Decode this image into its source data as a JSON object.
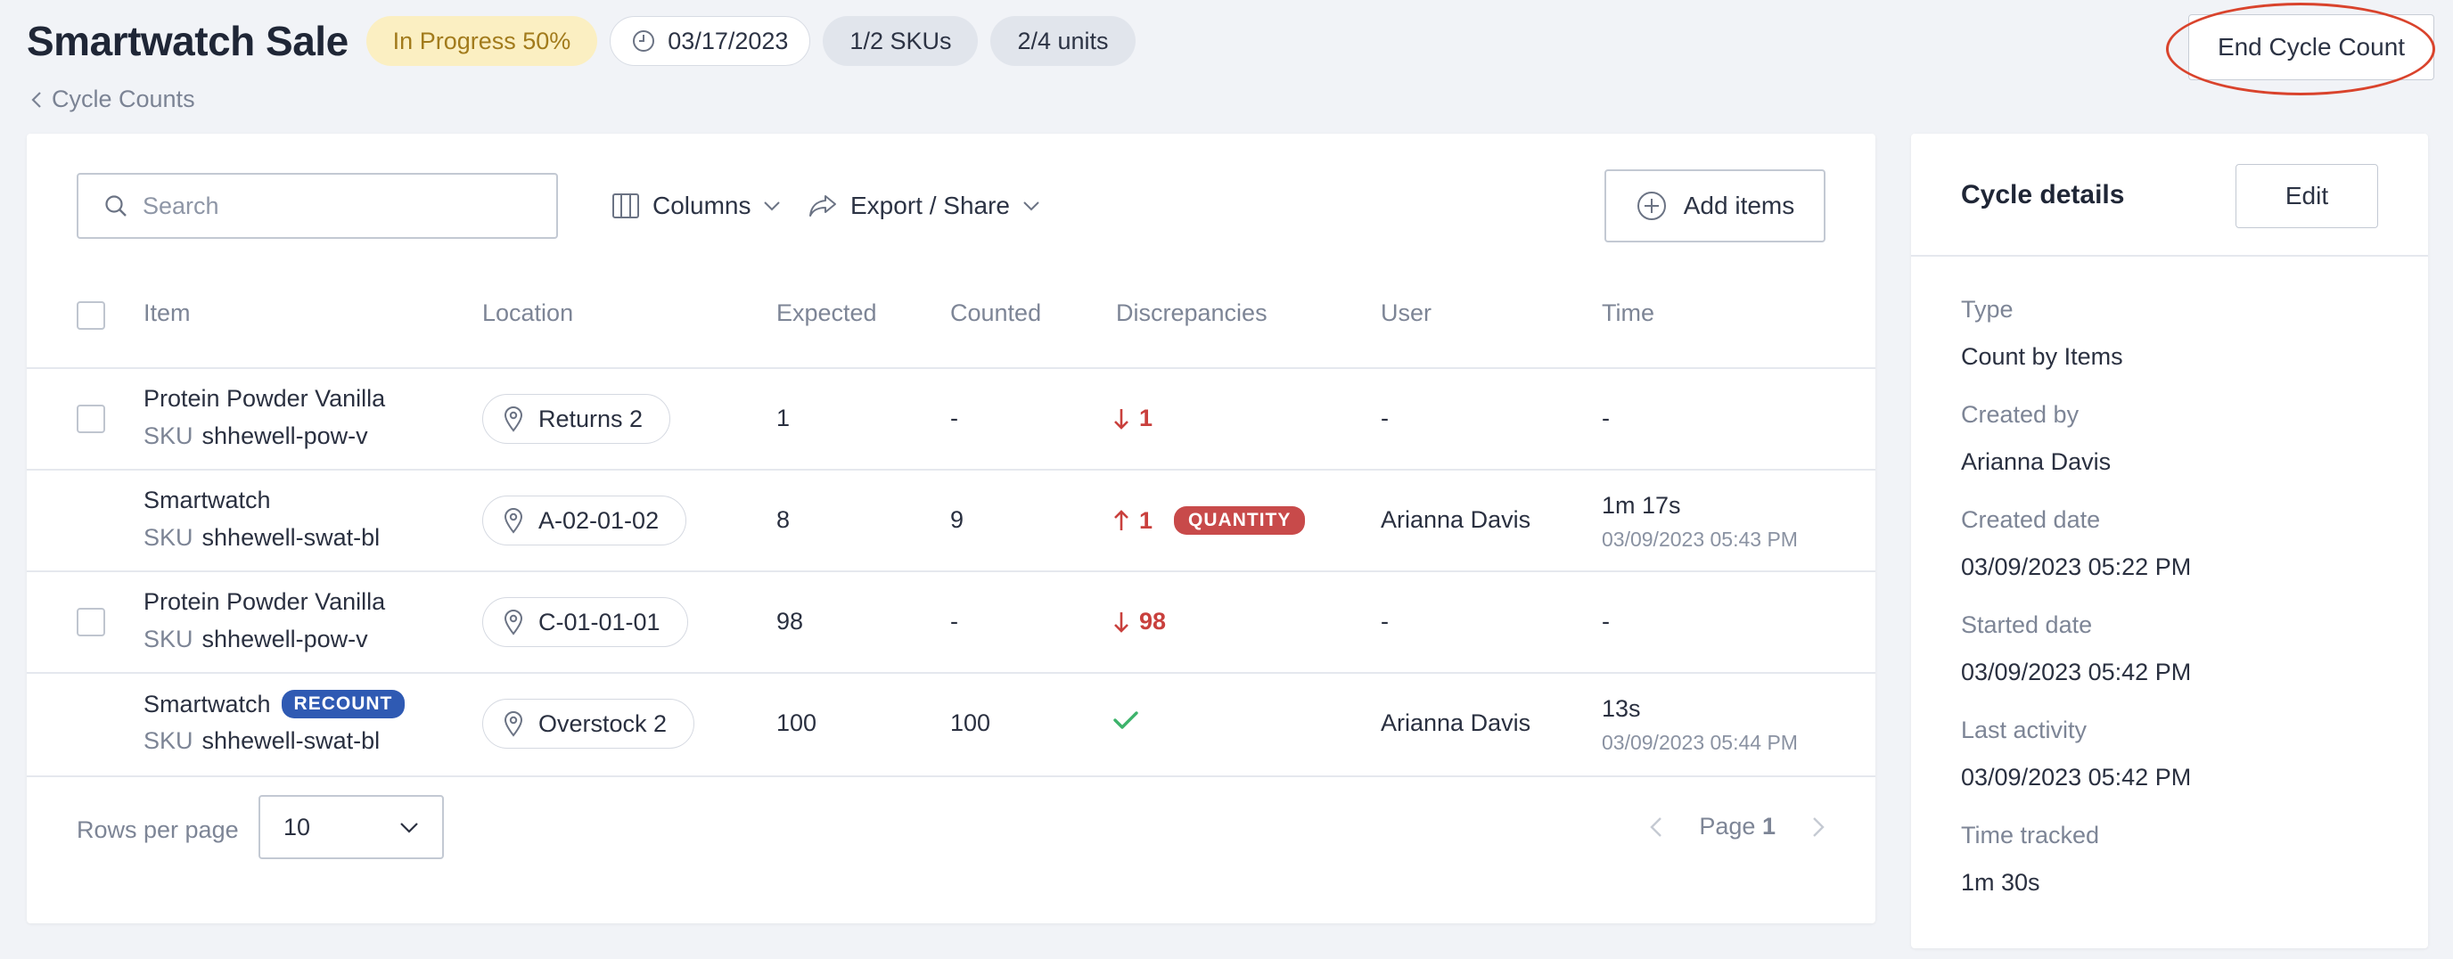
{
  "header": {
    "title": "Smartwatch Sale",
    "status": "In Progress 50%",
    "date": "03/17/2023",
    "skus": "1/2 SKUs",
    "units": "2/4 units",
    "breadcrumb": "Cycle Counts",
    "end_button": "End Cycle Count"
  },
  "toolbar": {
    "search_placeholder": "Search",
    "columns_label": "Columns",
    "export_label": "Export / Share",
    "add_label": "Add items"
  },
  "table": {
    "headers": [
      "Item",
      "Location",
      "Expected",
      "Counted",
      "Discrepancies",
      "User",
      "Time"
    ],
    "sku_label": "SKU",
    "rows": [
      {
        "item": "Protein Powder Vanilla",
        "sku": "shhewell-pow-v",
        "location": "Returns 2",
        "expected": "1",
        "counted": "-",
        "discrepancy": "1",
        "user": "-",
        "time": "-",
        "time_sub": ""
      },
      {
        "item": "Smartwatch",
        "sku": "shhewell-swat-bl",
        "location": "A-02-01-02",
        "expected": "8",
        "counted": "9",
        "discrepancy": "1",
        "discrepancy_badge": "QUANTITY",
        "user": "Arianna Davis",
        "time": "1m 17s",
        "time_sub": "03/09/2023 05:43 PM"
      },
      {
        "item": "Protein Powder Vanilla",
        "sku": "shhewell-pow-v",
        "location": "C-01-01-01",
        "expected": "98",
        "counted": "-",
        "discrepancy": "98",
        "user": "-",
        "time": "-",
        "time_sub": ""
      },
      {
        "item": "Smartwatch",
        "item_badge": "RECOUNT",
        "sku": "shhewell-swat-bl",
        "location": "Overstock 2",
        "expected": "100",
        "counted": "100",
        "discrepancy": "",
        "user": "Arianna Davis",
        "time": "13s",
        "time_sub": "03/09/2023 05:44 PM"
      }
    ]
  },
  "footer": {
    "rows_per_page_label": "Rows per page",
    "rows_per_page_value": "10",
    "page_label": "Page",
    "page_number": "1"
  },
  "details": {
    "title": "Cycle details",
    "edit_label": "Edit",
    "fields": [
      {
        "label": "Type",
        "value": "Count by Items"
      },
      {
        "label": "Created by",
        "value": "Arianna Davis"
      },
      {
        "label": "Created date",
        "value": "03/09/2023 05:22 PM"
      },
      {
        "label": "Started date",
        "value": "03/09/2023 05:42 PM"
      },
      {
        "label": "Last activity",
        "value": "03/09/2023 05:42 PM"
      },
      {
        "label": "Time tracked",
        "value": "1m 30s"
      }
    ]
  },
  "colors": {
    "danger": "#c9403d",
    "success": "#3db36b",
    "recount_badge": "#2f5ab3",
    "highlight_ring": "#d9432c",
    "progress_chip_bg": "#fbefc2"
  }
}
